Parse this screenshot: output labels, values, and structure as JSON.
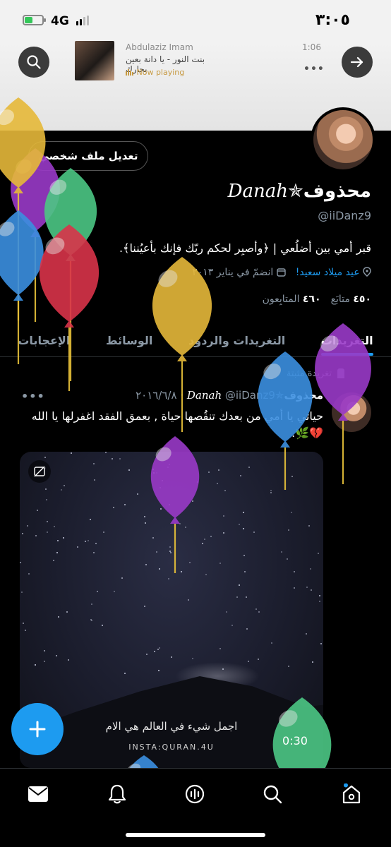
{
  "status_bar": {
    "time": "٣:٠٥",
    "network": "4G",
    "battery_level": 0.45,
    "signal_bars": 2,
    "colors": {
      "battery_fill": "#34c759"
    }
  },
  "now_playing": {
    "artist": "Abdulaziz Imam",
    "title": "بنت النور - يا دانة بعين بحارك",
    "elapsed": "1:06",
    "status": "Now playing",
    "more_icon": "more-horizontal-icon"
  },
  "header": {
    "search_icon": "search-icon",
    "forward_icon": "arrow-right-icon"
  },
  "profile": {
    "edit_button": "تعديل ملف شخصي",
    "name_ar": "محذوف",
    "name_star": "✯",
    "name_script": "Danah",
    "handle": "@iiDanz9",
    "bio": "قبر أمي بين أضلُعي | ﴿وأصبِر لحكم ربّك فإنك بأعيُننا﴾.",
    "birthday": "عيد ميلاد سعيد!",
    "joined": "انضمّ في يناير ٢٠١٣",
    "following_count": "٤٥٠",
    "following_label": "متابَع",
    "followers_count": "٤٦٠",
    "followers_label": "المتابِعون"
  },
  "tabs": [
    {
      "label": "التغريدات",
      "active": true
    },
    {
      "label": "التغريدات والردود",
      "active": false
    },
    {
      "label": "الوسائط",
      "active": false
    },
    {
      "label": "الإعجابات",
      "active": false
    }
  ],
  "pinned_post": {
    "pinned_label": "تغريدة مثبتة",
    "author_ar": "محذوف",
    "author_star": "✯",
    "author_script": "Danah",
    "handle": "@iiDanz9",
    "date": "٢٠١٦/٦/٨",
    "separator": "·",
    "text": "حياتي يا أمي من بعدك تنقُصها حياة , بعمق الفقد اغفرلها يا الله 💔🌿.",
    "media": {
      "caption": "اجمل شيء في العالم هي الام",
      "credit": "INSTA:QURAN.4U",
      "duration": "0:30"
    }
  },
  "fab": {
    "icon": "plus-icon"
  },
  "bottom_nav": [
    {
      "icon": "mail-icon"
    },
    {
      "icon": "bell-icon"
    },
    {
      "icon": "spaces-icon"
    },
    {
      "icon": "search-icon"
    },
    {
      "icon": "home-icon",
      "active": true
    }
  ],
  "balloon_colors": {
    "yellow": "#e6b93a",
    "purple": "#9a3ac8",
    "green": "#4cc784",
    "blue": "#3b8fe0",
    "red": "#d9344a"
  }
}
